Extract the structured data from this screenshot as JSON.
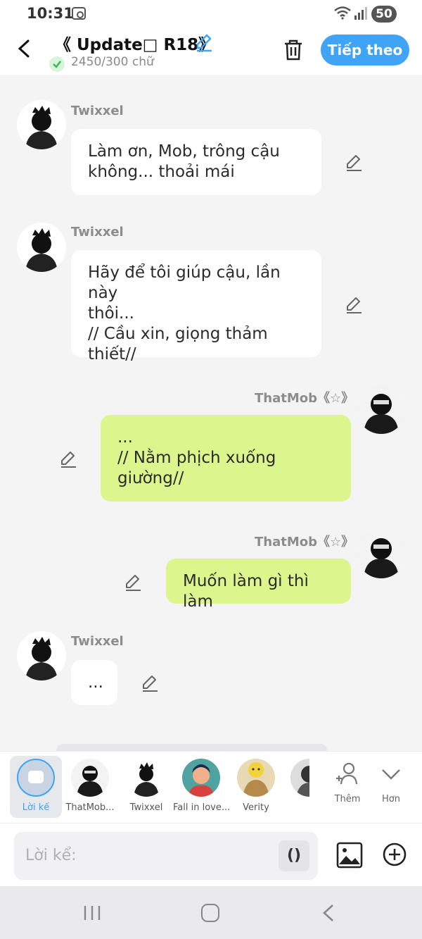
{
  "status_bar": {
    "time": "10:31",
    "battery": "50"
  },
  "header": {
    "title": "《 Update□ R18》",
    "word_count": "2450/300 chữ",
    "next_label": "Tiếp theo",
    "accent_color": "#3fa3f6"
  },
  "messages": [
    {
      "side": "left",
      "name": "Twixxel",
      "text": "Làm ơn, Mob, trông cậu\nkhông... thoải mái"
    },
    {
      "side": "left",
      "name": "Twixxel",
      "text": "Hãy để tôi giúp cậu, lần này\nthôi...\n// Cầu xin, giọng thảm\nthiết//"
    },
    {
      "side": "right",
      "name": "ThatMob《☆》",
      "text": "...\n// Nằm phịch xuống\ngiường//"
    },
    {
      "side": "right",
      "name": "ThatMob《☆》",
      "text": "Muốn làm gì thì làm"
    },
    {
      "side": "left",
      "name": "Twixxel",
      "text": "..."
    }
  ],
  "characters": [
    {
      "label": "Lời kế",
      "selected": true
    },
    {
      "label": "ThatMob..."
    },
    {
      "label": "Twixxel"
    },
    {
      "label": "Fall in love..."
    },
    {
      "label": "Verity"
    }
  ],
  "more_buttons": {
    "add_label": "Thêm",
    "more_label": "Hơn"
  },
  "input": {
    "placeholder": "Lời kể:",
    "paren_label": "()"
  }
}
